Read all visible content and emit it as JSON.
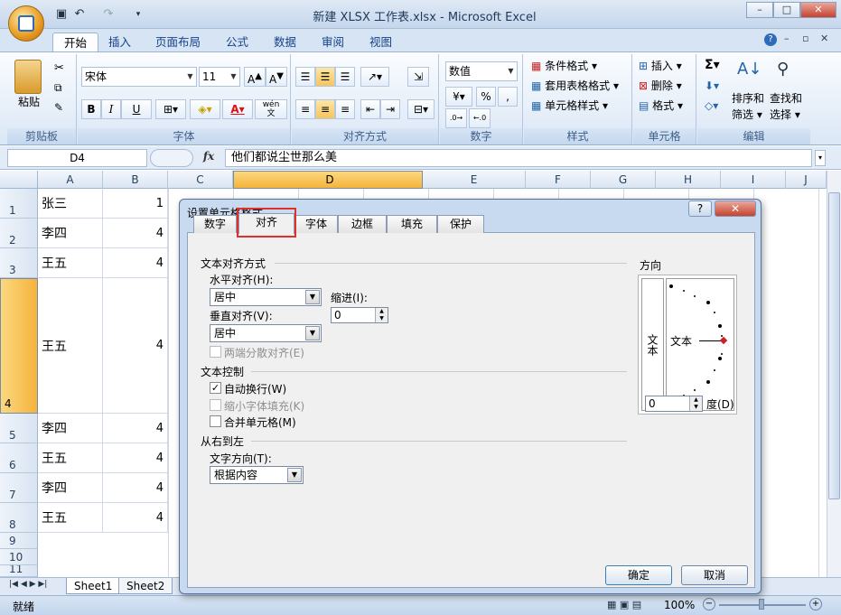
{
  "window": {
    "title": "新建 XLSX 工作表.xlsx - Microsoft Excel"
  },
  "ribbon_tabs": [
    "开始",
    "插入",
    "页面布局",
    "公式",
    "数据",
    "审阅",
    "视图"
  ],
  "ribbon": {
    "clipboard": {
      "paste": "粘贴",
      "label": "剪贴板"
    },
    "font": {
      "name": "宋体",
      "size": "11",
      "bold": "B",
      "italic": "I",
      "underline": "U",
      "wen": "wén",
      "wen2": "文",
      "label": "字体"
    },
    "alignment": {
      "label": "对齐方式"
    },
    "number": {
      "format": "数值",
      "percent": "%",
      "comma": ",",
      "label": "数字"
    },
    "styles": {
      "cond": "条件格式",
      "table": "套用表格格式",
      "cell": "单元格样式",
      "label": "样式"
    },
    "cells": {
      "insert": "插入",
      "delete": "删除",
      "format": "格式",
      "label": "单元格"
    },
    "editing": {
      "sigma": "Σ",
      "sort": "排序和",
      "sort2": "筛选",
      "find": "查找和",
      "find2": "选择",
      "label": "编辑"
    }
  },
  "formula_bar": {
    "name_box": "D4",
    "fx": "fx",
    "value": "他们都说尘世那么美"
  },
  "columns": [
    "A",
    "B",
    "C",
    "D",
    "E",
    "F",
    "G",
    "H",
    "I",
    "J"
  ],
  "rows": [
    {
      "num": "1",
      "a": "张三",
      "b": "1"
    },
    {
      "num": "2",
      "a": "李四",
      "b": "4"
    },
    {
      "num": "3",
      "a": "王五",
      "b": "4"
    },
    {
      "num": "4",
      "a": "王五",
      "b": "4"
    },
    {
      "num": "5",
      "a": "李四",
      "b": "4"
    },
    {
      "num": "6",
      "a": "王五",
      "b": "4"
    },
    {
      "num": "7",
      "a": "李四",
      "b": "4"
    },
    {
      "num": "8",
      "a": "王五",
      "b": "4"
    },
    {
      "num": "9",
      "a": "",
      "b": ""
    },
    {
      "num": "10",
      "a": "",
      "b": ""
    },
    {
      "num": "11",
      "a": "",
      "b": ""
    }
  ],
  "sheets": [
    "Sheet1",
    "Sheet2"
  ],
  "status": {
    "ready": "就绪",
    "zoom": "100%"
  },
  "dialog": {
    "title": "设置单元格格式",
    "help": "?",
    "close": "✕",
    "tabs": [
      "数字",
      "对齐",
      "字体",
      "边框",
      "填充",
      "保护"
    ],
    "text_align_section": "文本对齐方式",
    "horizontal_label": "水平对齐(H):",
    "horizontal_value": "居中",
    "indent_label": "缩进(I):",
    "indent_value": "0",
    "vertical_label": "垂直对齐(V):",
    "vertical_value": "居中",
    "justify_distributed": "两端分散对齐(E)",
    "text_control_section": "文本控制",
    "wrap_text": "自动换行(W)",
    "shrink_to_fit": "缩小字体填充(K)",
    "merge_cells": "合并单元格(M)",
    "rtl_section": "从右到左",
    "text_direction_label": "文字方向(T):",
    "text_direction_value": "根据内容",
    "orientation_section": "方向",
    "orientation_vertical_text": "文本",
    "orientation_text": "文本",
    "degrees_value": "0",
    "degrees_label": "度(D)",
    "ok": "确定",
    "cancel": "取消"
  }
}
